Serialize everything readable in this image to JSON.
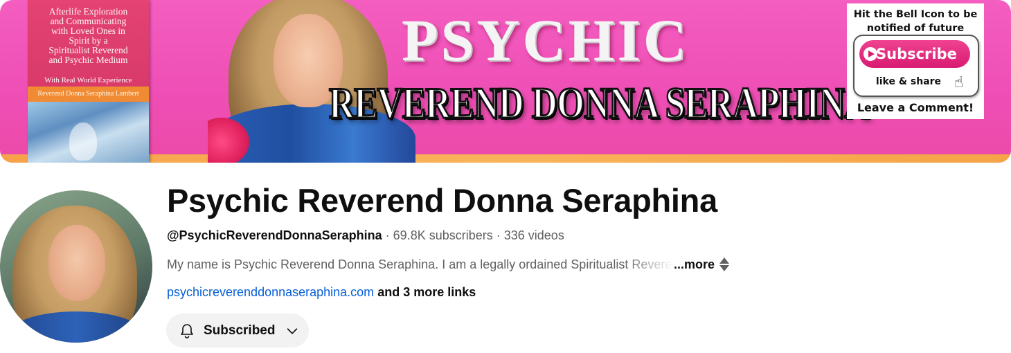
{
  "banner": {
    "book": {
      "title": "Afterlife Exploration\nand Communicating\nwith Loved Ones in\nSpirit by a\nSpiritualist Reverend\nand Psychic Medium",
      "subtitle": "With Real World Experience",
      "author": "Reverend Donna Seraphina Lambert"
    },
    "headline_top": "PSYCHIC",
    "headline_bottom": "REVEREND DONNA SERAPHINA",
    "promo": {
      "top_text": "Hit the Bell Icon to be notified of future videos",
      "subscribe_label": "Subscribe",
      "like_share": "like & share",
      "bottom_text": "Leave a Comment!"
    },
    "colors": {
      "background": "#ef4fb6",
      "strip": "#f7a24a"
    }
  },
  "channel": {
    "name": "Psychic Reverend Donna Seraphina",
    "handle": "@PsychicReverendDonnaSeraphina",
    "separator": " · ",
    "subscribers": "69.8K subscribers",
    "videos": "336 videos",
    "description": "My name is Psychic Reverend Donna Seraphina. I am a legally ordained Spiritualist Reverend",
    "more_label": "...more",
    "link_url": "psychicreverenddonnaseraphina.com",
    "more_links": "and 3 more links",
    "subscribed_label": "Subscribed",
    "icons": {
      "subscribe": "bell-icon",
      "dropdown": "chevron-down-icon",
      "more": "expand-icon"
    }
  }
}
